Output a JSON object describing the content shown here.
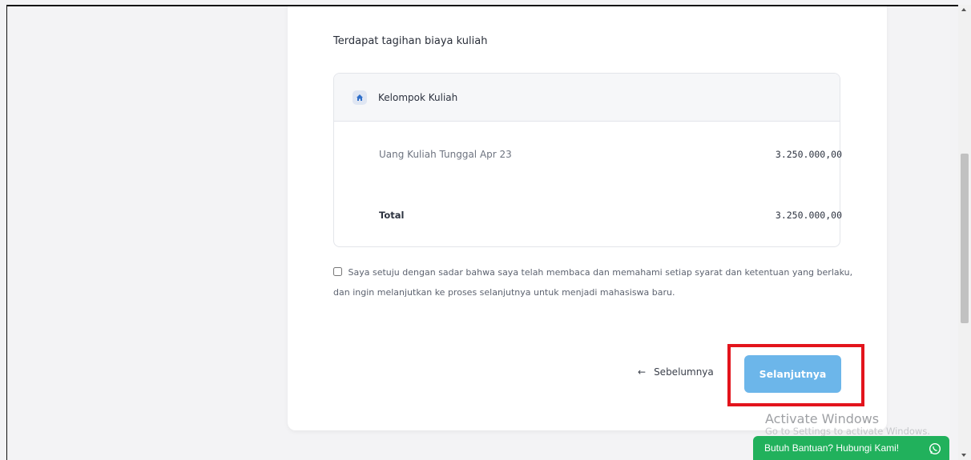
{
  "section": {
    "heading": "Terdapat tagihan biaya kuliah"
  },
  "billing": {
    "group_label": "Kelompok Kuliah",
    "group_icon": "home-icon",
    "item_label": "Uang Kuliah Tunggal Apr 23",
    "item_amount": "3.250.000,00",
    "total_label": "Total",
    "total_amount": "3.250.000,00"
  },
  "agreement": {
    "text": "Saya setuju dengan sadar bahwa saya telah membaca dan memahami setiap syarat dan ketentuan yang berlaku, dan ingin melanjutkan ke proses selanjutnya untuk menjadi mahasiswa baru.",
    "checked": false
  },
  "nav": {
    "prev_label": "Sebelumnya",
    "next_label": "Selanjutnya"
  },
  "watermark": {
    "line1": "Activate Windows",
    "line2": "Go to Settings to activate Windows."
  },
  "help": {
    "label": "Butuh Bantuan? Hubungi Kami!",
    "icon": "whatsapp-icon"
  },
  "colors": {
    "primary_button": "#6cb6ea",
    "highlight_box": "#e3141c",
    "help_chip": "#21b15c"
  }
}
